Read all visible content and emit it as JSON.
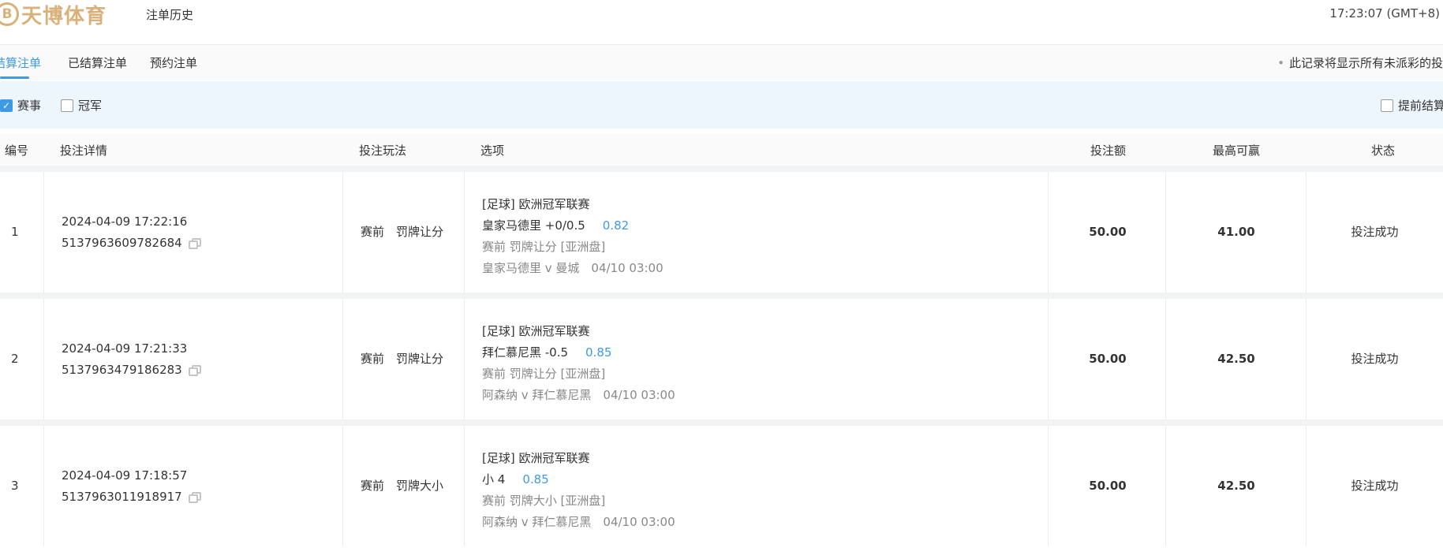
{
  "header": {
    "logo_mark": "B",
    "logo_text": "天博体育",
    "page_title": "注单历史",
    "clock": "17:23:07 (GMT+8)"
  },
  "tabs": [
    {
      "label": "结算注单",
      "active": true
    },
    {
      "label": "已结算注单",
      "active": false
    },
    {
      "label": "预约注单",
      "active": false
    }
  ],
  "notice": "此记录将显示所有未派彩的投",
  "filters": {
    "event_label": "赛事",
    "event_checked": true,
    "champion_label": "冠军",
    "champion_checked": false,
    "early_settle_label": "提前结算"
  },
  "columns": [
    "编号",
    "投注详情",
    "投注玩法",
    "选项",
    "投注额",
    "最高可赢",
    "状态"
  ],
  "rows": [
    {
      "num": "1",
      "datetime": "2024-04-09 17:22:16",
      "bet_id": "5137963609782684",
      "play": "赛前　罚牌让分",
      "league": "[足球] 欧洲冠军联赛",
      "selection": "皇家马德里 +0/0.5",
      "odds": "0.82",
      "market": "赛前 罚牌让分 [亚洲盘]",
      "match": "皇家马德里 v 曼城　04/10 03:00",
      "amount": "50.00",
      "max_win": "41.00",
      "status": "投注成功"
    },
    {
      "num": "2",
      "datetime": "2024-04-09 17:21:33",
      "bet_id": "5137963479186283",
      "play": "赛前　罚牌让分",
      "league": "[足球] 欧洲冠军联赛",
      "selection": "拜仁慕尼黑 -0.5",
      "odds": "0.85",
      "market": "赛前 罚牌让分 [亚洲盘]",
      "match": "阿森纳 v 拜仁慕尼黑　04/10 03:00",
      "amount": "50.00",
      "max_win": "42.50",
      "status": "投注成功"
    },
    {
      "num": "3",
      "datetime": "2024-04-09 17:18:57",
      "bet_id": "5137963011918917",
      "play": "赛前　罚牌大小",
      "league": "[足球] 欧洲冠军联赛",
      "selection": "小 4",
      "odds": "0.85",
      "market": "赛前 罚牌大小 [亚洲盘]",
      "match": "阿森纳 v 拜仁慕尼黑　04/10 03:00",
      "amount": "50.00",
      "max_win": "42.50",
      "status": "投注成功"
    }
  ]
}
